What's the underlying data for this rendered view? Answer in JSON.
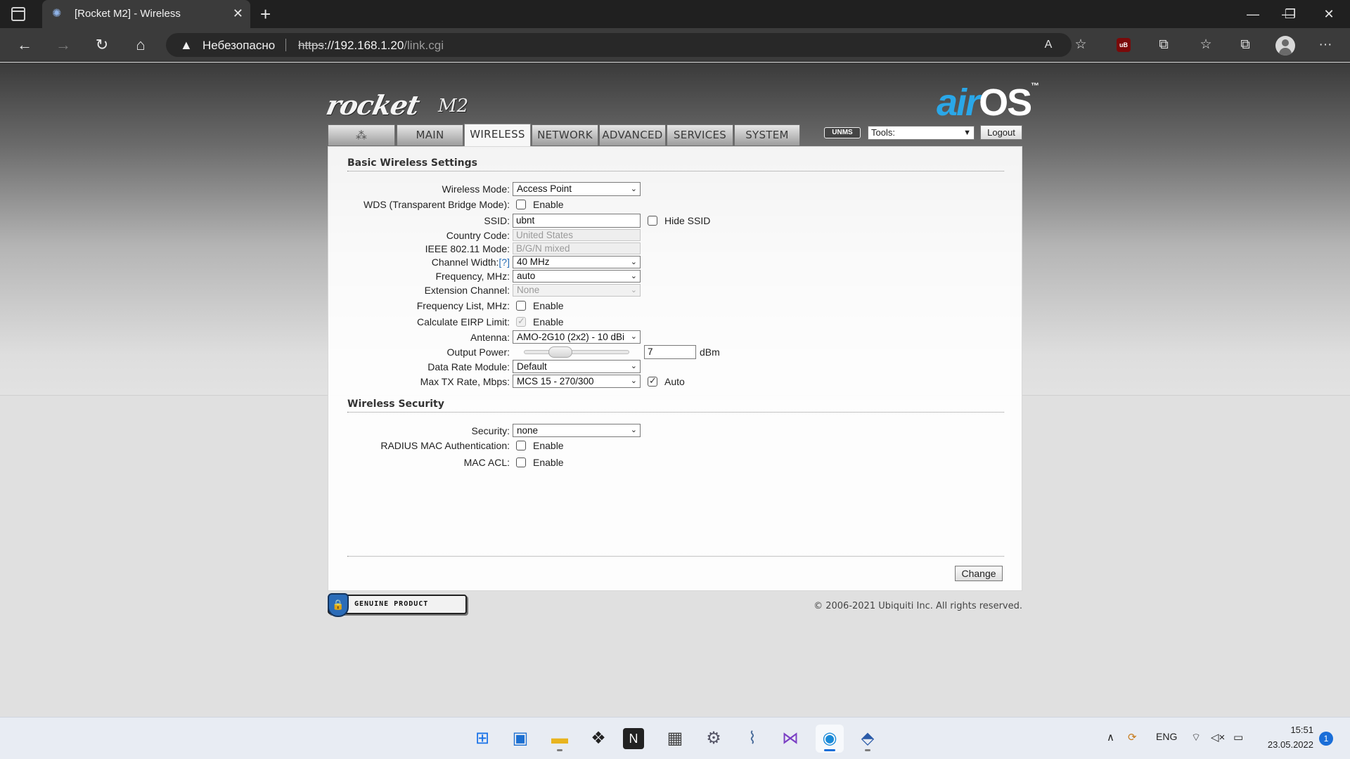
{
  "browser": {
    "tab_title": "[Rocket M2] - Wireless",
    "tab_close": "✕",
    "new_tab": "+",
    "window_controls": {
      "minimize": "—",
      "maximize": "❐",
      "close": "✕"
    },
    "nav": {
      "back": "←",
      "forward": "→",
      "reload": "↻",
      "home": "⌂"
    },
    "security_label": "Небезопасно",
    "url_scheme": "https",
    "url_host": "://192.168.1.20",
    "url_path": "/link.cgi",
    "toolbar": {
      "read_aloud": "A",
      "add_favorite": "☆",
      "ublock": "uB",
      "extensions": "⧉",
      "favorites": "☆",
      "collections": "⧉",
      "menu": "···"
    }
  },
  "brand": {
    "product": "rocket",
    "model": "M2",
    "air": "air",
    "os": "OS",
    "tm": "™"
  },
  "tabs": [
    {
      "label": ""
    },
    {
      "label": "MAIN"
    },
    {
      "label": "WIRELESS"
    },
    {
      "label": "NETWORK"
    },
    {
      "label": "ADVANCED"
    },
    {
      "label": "SERVICES"
    },
    {
      "label": "SYSTEM"
    }
  ],
  "header_tools": {
    "unms": "UNMS",
    "tools_value": "Tools:",
    "logout": "Logout"
  },
  "basic": {
    "title": "Basic Wireless Settings",
    "wireless_mode": {
      "label": "Wireless Mode:",
      "value": "Access Point"
    },
    "wds": {
      "label": "WDS (Transparent Bridge Mode):",
      "option": "Enable",
      "checked": false
    },
    "ssid": {
      "label": "SSID:",
      "value": "ubnt",
      "hide_label": "Hide SSID",
      "hide_checked": false
    },
    "country": {
      "label": "Country Code:",
      "value": "United States"
    },
    "ieee": {
      "label": "IEEE 802.11 Mode:",
      "value": "B/G/N mixed"
    },
    "channel_width": {
      "label": "Channel Width:",
      "help": "[?]",
      "value": "40 MHz"
    },
    "frequency": {
      "label": "Frequency, MHz:",
      "value": "auto"
    },
    "extension_channel": {
      "label": "Extension Channel:",
      "value": "None"
    },
    "frequency_list": {
      "label": "Frequency List, MHz:",
      "option": "Enable",
      "checked": false
    },
    "eirp": {
      "label": "Calculate EIRP Limit:",
      "option": "Enable",
      "checked": true
    },
    "antenna": {
      "label": "Antenna:",
      "value": "AMO-2G10 (2x2) - 10 dBi"
    },
    "output_power": {
      "label": "Output Power:",
      "value": "7",
      "unit": "dBm",
      "slider_level": 0.3
    },
    "data_rate_module": {
      "label": "Data Rate Module:",
      "value": "Default"
    },
    "max_tx_rate": {
      "label": "Max TX Rate, Mbps:",
      "value": "MCS 15 - 270/300",
      "auto_label": "Auto",
      "auto_checked": true
    }
  },
  "security": {
    "title": "Wireless Security",
    "security": {
      "label": "Security:",
      "value": "none"
    },
    "radius": {
      "label": "RADIUS MAC Authentication:",
      "option": "Enable",
      "checked": false
    },
    "mac_acl": {
      "label": "MAC ACL:",
      "option": "Enable",
      "checked": false
    }
  },
  "change_button": "Change",
  "genuine_badge": "GENUINE PRODUCT",
  "copyright": "© 2006-2021 Ubiquiti Inc. All rights reserved.",
  "taskbar": {
    "apps": [
      "start-icon",
      "desktop-icon",
      "file-explorer-icon",
      "dropbox-icon",
      "notion-icon",
      "calculator-icon",
      "settings-icon",
      "resource-monitor-icon",
      "visual-studio-icon",
      "edge-icon",
      "winbox-icon"
    ],
    "language": "ENG",
    "time": "15:51",
    "date": "23.05.2022",
    "notifications": "1"
  }
}
